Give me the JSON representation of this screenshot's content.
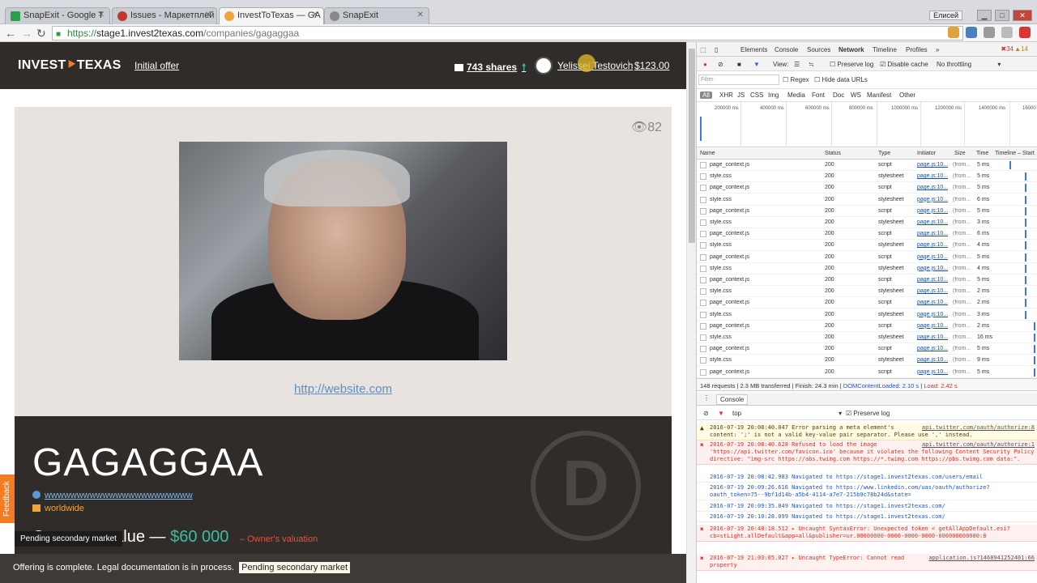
{
  "browser": {
    "tabs": [
      {
        "title": "SnapExit - Google T",
        "color": "#2e9e4f"
      },
      {
        "title": "Issues - Маркетплей",
        "color": "#c0392b"
      },
      {
        "title": "InvestToTexas — GA",
        "color": "#f0a43a"
      },
      {
        "title": "SnapExit",
        "color": "#888888"
      }
    ],
    "active_tab": 2,
    "username": "Елисей",
    "url_scheme": "https://",
    "url_host": "stage1.invest2texas.com",
    "url_path": "/companies/gagaggaa"
  },
  "site": {
    "logo_left": "INVEST",
    "logo_arrow": "⯈",
    "logo_right": "TEXAS",
    "nav_initial_offer": "Initial offer",
    "shares": "743 shares",
    "user_name": "Yelissei Testovich",
    "balance": "$123.00",
    "views": "82",
    "website_link": "http://website.com",
    "company_name": "GAGAGGAA",
    "company_url": "wwwwwwwwwwwwwwwwwwwwwww",
    "company_geo": "worldwide",
    "value_label": "Company value —",
    "value_amount": "$60 000",
    "value_note": "– Owner's valuation",
    "logo_letter": "D",
    "pending_tooltip": "Pending secondary market",
    "offer_text": "Offering is complete. Legal documentation is in process.",
    "offer_badge": "Pending secondary market",
    "feedback": "Feedback"
  },
  "devtools": {
    "tabs": [
      "Elements",
      "Console",
      "Sources",
      "Network",
      "Timeline",
      "Profiles",
      "»"
    ],
    "errors": "34",
    "warnings": "14",
    "view_label": "View:",
    "preserve_log": "Preserve log",
    "disable_cache": "Disable cache",
    "throttling": "No throttling",
    "filter_placeholder": "Filter",
    "regex": "Regex",
    "hide_data_urls": "Hide data URLs",
    "types": [
      "All",
      "XHR",
      "JS",
      "CSS",
      "Img",
      "Media",
      "Font",
      "Doc",
      "WS",
      "Manifest",
      "Other"
    ],
    "timeline_ticks": [
      "200000 ms",
      "400000 ms",
      "600000 ms",
      "800000 ms",
      "1000000 ms",
      "1200000 ms",
      "1400000 ms",
      "16000"
    ],
    "columns": [
      "Name",
      "Status",
      "Type",
      "Initiator",
      "Size",
      "Time",
      "Timeline – Start"
    ],
    "requests": [
      {
        "name": "page_context.js",
        "status": "200",
        "type": "script",
        "init": "page.js:10...",
        "size": "(from...",
        "time": "5 ms"
      },
      {
        "name": "style.css",
        "status": "200",
        "type": "stylesheet",
        "init": "page.js:10...",
        "size": "(from...",
        "time": "5 ms"
      },
      {
        "name": "page_context.js",
        "status": "200",
        "type": "script",
        "init": "page.js:10...",
        "size": "(from...",
        "time": "5 ms"
      },
      {
        "name": "style.css",
        "status": "200",
        "type": "stylesheet",
        "init": "page.js:10...",
        "size": "(from...",
        "time": "6 ms"
      },
      {
        "name": "page_context.js",
        "status": "200",
        "type": "script",
        "init": "page.js:10...",
        "size": "(from...",
        "time": "5 ms"
      },
      {
        "name": "style.css",
        "status": "200",
        "type": "stylesheet",
        "init": "page.js:10...",
        "size": "(from...",
        "time": "3 ms"
      },
      {
        "name": "page_context.js",
        "status": "200",
        "type": "script",
        "init": "page.js:10...",
        "size": "(from...",
        "time": "6 ms"
      },
      {
        "name": "style.css",
        "status": "200",
        "type": "stylesheet",
        "init": "page.js:10...",
        "size": "(from...",
        "time": "4 ms"
      },
      {
        "name": "page_context.js",
        "status": "200",
        "type": "script",
        "init": "page.js:10...",
        "size": "(from...",
        "time": "5 ms"
      },
      {
        "name": "style.css",
        "status": "200",
        "type": "stylesheet",
        "init": "page.js:10...",
        "size": "(from...",
        "time": "4 ms"
      },
      {
        "name": "page_context.js",
        "status": "200",
        "type": "script",
        "init": "page.js:10...",
        "size": "(from...",
        "time": "5 ms"
      },
      {
        "name": "style.css",
        "status": "200",
        "type": "stylesheet",
        "init": "page.js:10...",
        "size": "(from...",
        "time": "2 ms"
      },
      {
        "name": "page_context.js",
        "status": "200",
        "type": "script",
        "init": "page.js:10...",
        "size": "(from...",
        "time": "2 ms"
      },
      {
        "name": "style.css",
        "status": "200",
        "type": "stylesheet",
        "init": "page.js:10...",
        "size": "(from...",
        "time": "3 ms"
      },
      {
        "name": "page_context.js",
        "status": "200",
        "type": "script",
        "init": "page.js:10...",
        "size": "(from...",
        "time": "2 ms"
      },
      {
        "name": "style.css",
        "status": "200",
        "type": "stylesheet",
        "init": "page.js:10...",
        "size": "(from...",
        "time": "16 ms"
      },
      {
        "name": "page_context.js",
        "status": "200",
        "type": "script",
        "init": "page.js:10...",
        "size": "(from...",
        "time": "5 ms"
      },
      {
        "name": "style.css",
        "status": "200",
        "type": "stylesheet",
        "init": "page.js:10...",
        "size": "(from...",
        "time": "9 ms"
      },
      {
        "name": "page_context.js",
        "status": "200",
        "type": "script",
        "init": "page.js:10...",
        "size": "(from...",
        "time": "5 ms"
      }
    ],
    "summary_requests": "148 requests | 2.3 MB transferred | Finish: 24.3 min |",
    "summary_dcl": "DOMContentLoaded: 2.10 s",
    "summary_load": "Load: 2.42 s",
    "console_tab": "Console",
    "console_context": "top",
    "console_preserve": "Preserve log",
    "console_lines": [
      {
        "kind": "warn",
        "icon": "▲",
        "text": "2016-07-19 20:08:40.047 Error parsing a meta element's content: ';' is not a valid key-value pair separator. Please use ',' instead.",
        "src": "api.twitter.com/oauth/authorize:8"
      },
      {
        "kind": "err",
        "icon": "✖",
        "text": "2016-07-19 20:08:40.628 Refused to load the image 'https://api.twitter.com/favicon.ico' because it violates the following Content Security Policy directive: \"img-src https://abs.twimg.com https://*.twimg.com https://pbs.twimg.com data:\".",
        "src": "api.twitter.com/oauth/authorize:1"
      },
      {
        "kind": "info",
        "icon": "",
        "text": "2016-07-19 20:08:42.983 Navigated to https://stage1.invest2texas.com/users/email",
        "src": ""
      },
      {
        "kind": "info",
        "icon": "",
        "text": "2016-07-19 20:09:26.616 Navigated to https://www.linkedin.com/uas/oauth/authorize?oauth_token=75--9bf1d14b-a5b4-4114-a7e7-215b9c78b24d&state=",
        "src": ""
      },
      {
        "kind": "info",
        "icon": "",
        "text": "2016-07-19 20:09:35.849 Navigated to https://stage1.invest2texas.com/",
        "src": ""
      },
      {
        "kind": "info",
        "icon": "",
        "text": "2016-07-19 20:10:28.099 Navigated to https://stage1.invest2texas.com/",
        "src": ""
      },
      {
        "kind": "err",
        "icon": "✖",
        "text": "2016-07-19 20:48:18.512 ▸ Uncaught SyntaxError: Unexpected token < getAllAppDefault.esi?cb=stLight.allDefault&app=all&publisher=ur.00000000-0000-0000-0000-000000000000:8",
        "src": ""
      },
      {
        "kind": "err",
        "icon": "✖",
        "text": "2016-07-19 21:03:05.027 ▸ Uncaught TypeError: Cannot read property",
        "src": "application.js?1468941252401:66"
      }
    ]
  }
}
